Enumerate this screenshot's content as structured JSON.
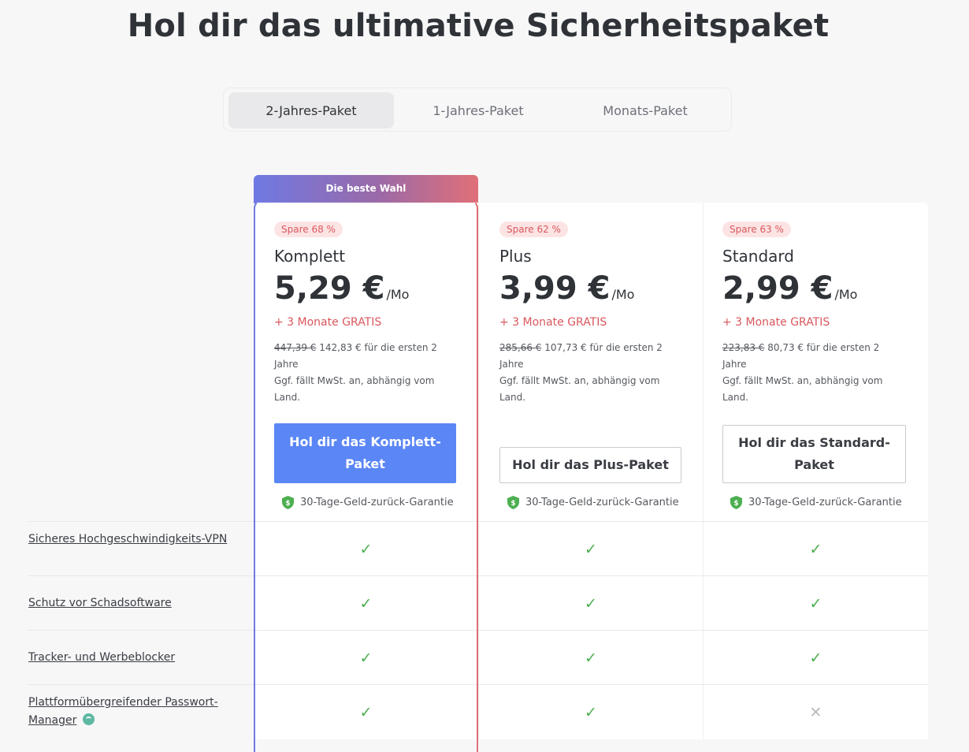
{
  "page": {
    "title": "Hol dir das ultimative Sicherheitspaket"
  },
  "tabs": [
    {
      "label": "2-Jahres-Paket",
      "active": true
    },
    {
      "label": "1-Jahres-Paket",
      "active": false
    },
    {
      "label": "Monats-Paket",
      "active": false
    }
  ],
  "best_badge": "Die beste Wahl",
  "plans": [
    {
      "save": "Spare 68 %",
      "name": "Komplett",
      "price": "5,29 €",
      "per": "/Mo",
      "bonus": "+ 3 Monate GRATIS",
      "old_price": "447,39 €",
      "new_price_text": " 142,83 € für die ersten 2 Jahre",
      "tax_note": "Ggf. fällt MwSt. an, abhängig vom Land.",
      "button": "Hol dir das Komplett-Paket",
      "guarantee": "30-Tage-Geld-zurück-Garantie"
    },
    {
      "save": "Spare 62 %",
      "name": "Plus",
      "price": "3,99 €",
      "per": "/Mo",
      "bonus": "+ 3 Monate GRATIS",
      "old_price": "285,66 €",
      "new_price_text": " 107,73 € für die ersten 2 Jahre",
      "tax_note": "Ggf. fällt MwSt. an, abhängig vom Land.",
      "button": "Hol dir das Plus-Paket",
      "guarantee": "30-Tage-Geld-zurück-Garantie"
    },
    {
      "save": "Spare 63 %",
      "name": "Standard",
      "price": "2,99 €",
      "per": "/Mo",
      "bonus": "+ 3 Monate GRATIS",
      "old_price": "223,83 €",
      "new_price_text": " 80,73 € für die ersten 2 Jahre",
      "tax_note": "Ggf. fällt MwSt. an, abhängig vom Land.",
      "button": "Hol dir das Standard-Paket",
      "guarantee": "30-Tage-Geld-zurück-Garantie"
    }
  ],
  "features": [
    {
      "label": "Sicheres Hochgeschwindigkeits-VPN",
      "values": [
        "✓",
        "✓",
        "✓"
      ]
    },
    {
      "label": "Schutz vor Schadsoftware",
      "values": [
        "✓",
        "✓",
        "✓"
      ]
    },
    {
      "label": "Tracker- und Werbeblocker",
      "values": [
        "✓",
        "✓",
        "✓"
      ]
    },
    {
      "label": "Plattformübergreifender Passwort-Manager",
      "values": [
        "✓",
        "✓",
        "✕"
      ],
      "info_icon": "info-badge-icon"
    }
  ],
  "colors": {
    "accent_blue": "#5b86f5",
    "sale_red": "#d9585e",
    "check_green": "#4caf50",
    "gradient_start": "#6f79e3",
    "gradient_end": "#e06f78"
  }
}
